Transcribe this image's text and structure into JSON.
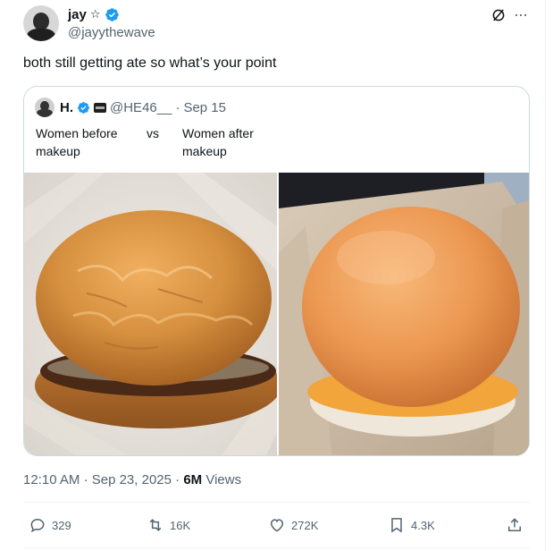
{
  "author": {
    "display_name": "jay",
    "name_suffix": "☆",
    "handle": "@jayythewave",
    "verified": true
  },
  "tweet": {
    "text": "both still getting ate so what’s your point"
  },
  "quote": {
    "display_name": "H.",
    "handle": "@HE46__",
    "separator": "·",
    "date": "Sep 15",
    "left_text": "Women before makeup",
    "vs_text": "vs",
    "right_text": "Women after makeup",
    "images": [
      "real-burger-photo",
      "smooth-burger-photo"
    ]
  },
  "meta": {
    "time": "12:10 AM",
    "separator1": "·",
    "date": "Sep 23, 2025",
    "separator2": "·",
    "views_count": "6M",
    "views_label": "Views"
  },
  "actions": {
    "replies": "329",
    "reposts": "16K",
    "likes": "272K",
    "bookmarks": "4.3K"
  },
  "colors": {
    "accent": "#1d9bf0",
    "muted": "#536471",
    "text": "#0f1419",
    "border": "#cfd9de"
  }
}
